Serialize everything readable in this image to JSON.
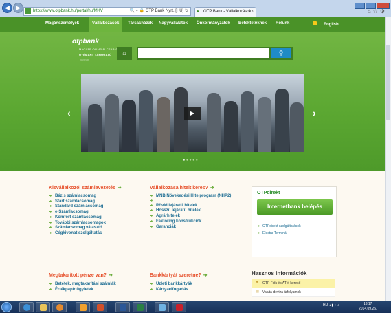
{
  "browser": {
    "url": "https://www.otpbank.hu/portal/hu/MKV",
    "site_tag": "OTP Bank Nyrt. [HU]",
    "tab_title": "OTP Bank - Vállalkozások"
  },
  "nav": {
    "items": [
      "Magánszemélyek",
      "Vállalkozások",
      "Társasházak",
      "Nagyvállalatok",
      "Önkormányzatok",
      "Befektetőknek",
      "Rólunk"
    ],
    "active": "Vállalkozások",
    "lang": "English"
  },
  "brand": {
    "logo": "otpbank",
    "sponsor": "MAGYAR OLIMPIAI CSAPAT",
    "sponsor_level": "GYÉMÁNT TÁMOGATÓ",
    "rings": "○○○○○"
  },
  "search": {
    "value": "",
    "placeholder": ""
  },
  "carousel": {
    "prev": "‹",
    "next": "›",
    "play": "▶",
    "dots": 5,
    "active_dot": 1
  },
  "sections": {
    "small_business": {
      "title": "Kisvállalkozói számlavezetés",
      "items": [
        "Bázis számlacsomag",
        "Start számlacsomag",
        "Standard számlacsomag",
        "e-Számlacsomag",
        "Komfort számlacsomag",
        "További számlacsomagok",
        "Számlacsomag választó",
        "Cégkivonat szolgáltatás"
      ]
    },
    "credit": {
      "title": "Vállalkozása hitelt keres?",
      "items": [
        "MNB Növekedési Hitelprogram (NHP2)",
        "Rövid lejáratú hitelek",
        "Hosszú lejáratú hitelek",
        "Agrárhitelek",
        "Faktoring konstrukciók",
        "Garanciák"
      ]
    },
    "savings": {
      "title": "Megtakarított pénze van?",
      "items": [
        "Betétek, megtakarítási számlák",
        "Értékpapír ügyletek"
      ]
    },
    "cards": {
      "title": "Bankkártyát szeretne?",
      "items": [
        "Üzleti bankkártyák",
        "Kártyaelfogadás"
      ]
    }
  },
  "otpdirekt": {
    "title": "OTPdirekt",
    "button": "Internetbank belépés",
    "links": [
      "OTPdirekt szolgáltatások",
      "Electra Terminál"
    ]
  },
  "useful": {
    "title": "Hasznos információk",
    "items": [
      "OTP Fiók és ATM kereső",
      "Valuta-deviza árfolyamok"
    ]
  },
  "taskbar": {
    "lang": "HU",
    "time": "13:17",
    "date": "2014.09.25."
  }
}
